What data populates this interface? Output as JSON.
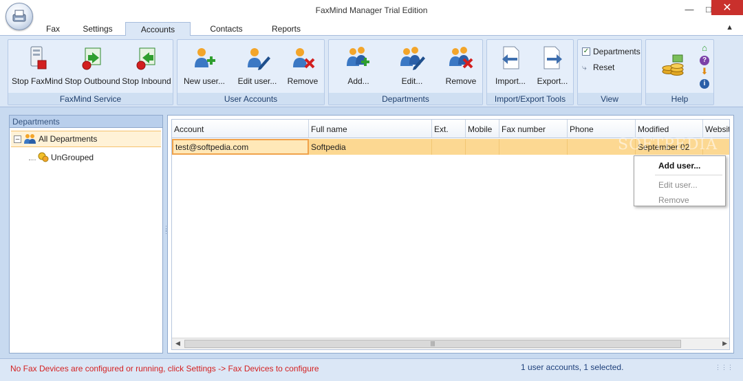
{
  "window": {
    "title": "FaxMind Manager Trial Edition",
    "minimize_icon": "minimize-icon",
    "maximize_icon": "maximize-icon",
    "close_icon": "close-icon"
  },
  "tabs": [
    {
      "label": "Fax",
      "active": false
    },
    {
      "label": "Settings",
      "active": false
    },
    {
      "label": "Accounts",
      "active": true
    },
    {
      "label": "Contacts",
      "active": false
    },
    {
      "label": "Reports",
      "active": false
    }
  ],
  "ribbon": {
    "groups": [
      {
        "label": "FaxMind Service",
        "buttons": [
          "Stop FaxMind",
          "Stop Outbound",
          "Stop Inbound"
        ]
      },
      {
        "label": "User Accounts",
        "buttons": [
          "New user...",
          "Edit user...",
          "Remove"
        ]
      },
      {
        "label": "Departments",
        "buttons": [
          "Add...",
          "Edit...",
          "Remove"
        ]
      },
      {
        "label": "Import/Export Tools",
        "buttons": [
          "Import...",
          "Export..."
        ]
      },
      {
        "label": "View",
        "items": [
          "Departments",
          "Reset"
        ]
      },
      {
        "label": "Help"
      }
    ],
    "colors": {
      "accent_green": "#2f9e2f",
      "accent_red": "#d21f1f",
      "accent_blue": "#2a5fa8",
      "accent_orange": "#f39c1a"
    }
  },
  "departments_panel": {
    "header": "Departments",
    "tree": [
      {
        "label": "All Departments",
        "expander": "⊟",
        "selected": true
      },
      {
        "label": "UnGrouped",
        "selected": false
      }
    ]
  },
  "grid": {
    "columns": [
      "Account",
      "Full name",
      "Ext.",
      "Mobile",
      "Fax number",
      "Phone",
      "Modified",
      "Website"
    ],
    "rows": [
      {
        "Account": "test@softpedia.com",
        "Full name": "Softpedia",
        "Ext.": "",
        "Mobile": "",
        "Fax number": "",
        "Phone": "",
        "Modified": "September 02",
        "Website": ""
      }
    ]
  },
  "context_menu": {
    "items": [
      {
        "label": "Add user...",
        "enabled": true
      },
      {
        "label": "Edit user...",
        "enabled": false
      },
      {
        "label": "Remove",
        "enabled": false
      }
    ]
  },
  "watermark": "SOFTPEDIA",
  "status": {
    "left": "No Fax Devices are configured or running, click Settings -> Fax Devices to configure",
    "right": "1 user accounts, 1 selected.",
    "left_color": "#d42020"
  }
}
